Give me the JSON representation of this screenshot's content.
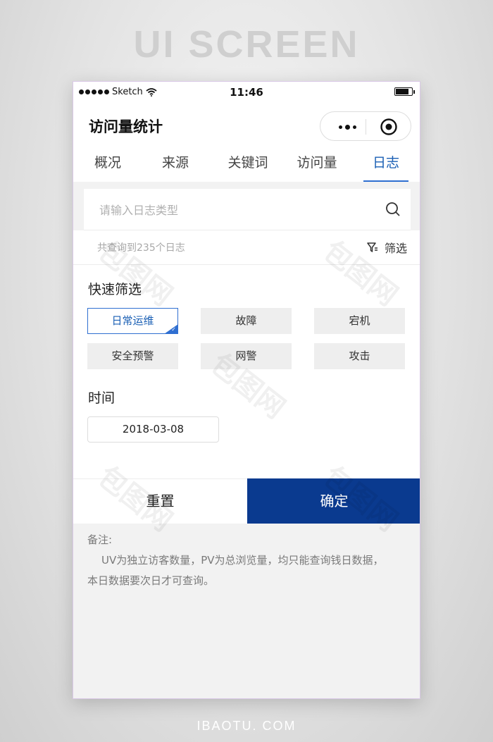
{
  "banner": {
    "title": "UI SCREEN",
    "footer": "IBAOTU. COM"
  },
  "statusbar": {
    "carrier": "Sketch",
    "time": "11:46"
  },
  "navbar": {
    "title": "访问量统计"
  },
  "tabs": [
    {
      "label": "概况",
      "active": false
    },
    {
      "label": "来源",
      "active": false
    },
    {
      "label": "关键词",
      "active": false
    },
    {
      "label": "访问量",
      "active": false
    },
    {
      "label": "日志",
      "active": true
    }
  ],
  "search": {
    "placeholder": "请输入日志类型",
    "value": ""
  },
  "result": {
    "count_text": "共查询到235个日志",
    "filter_label": "筛选"
  },
  "quick_filter": {
    "title": "快速筛选",
    "chips": [
      {
        "label": "日常运维",
        "selected": true
      },
      {
        "label": "故障",
        "selected": false
      },
      {
        "label": "宕机",
        "selected": false
      },
      {
        "label": "安全预警",
        "selected": false
      },
      {
        "label": "网警",
        "selected": false
      },
      {
        "label": "攻击",
        "selected": false
      }
    ]
  },
  "time": {
    "title": "时间",
    "date": "2018-03-08"
  },
  "actions": {
    "reset_label": "重置",
    "confirm_label": "确定"
  },
  "note": {
    "title": "备注:",
    "line1": "UV为独立访客数量，PV为总浏览量，均只能查询钱日数据，",
    "line2": "本日数据要次日才可查询。"
  },
  "colors": {
    "accent": "#2f6fd1",
    "primary_button": "#0a3a8f"
  },
  "watermark": "包图网"
}
